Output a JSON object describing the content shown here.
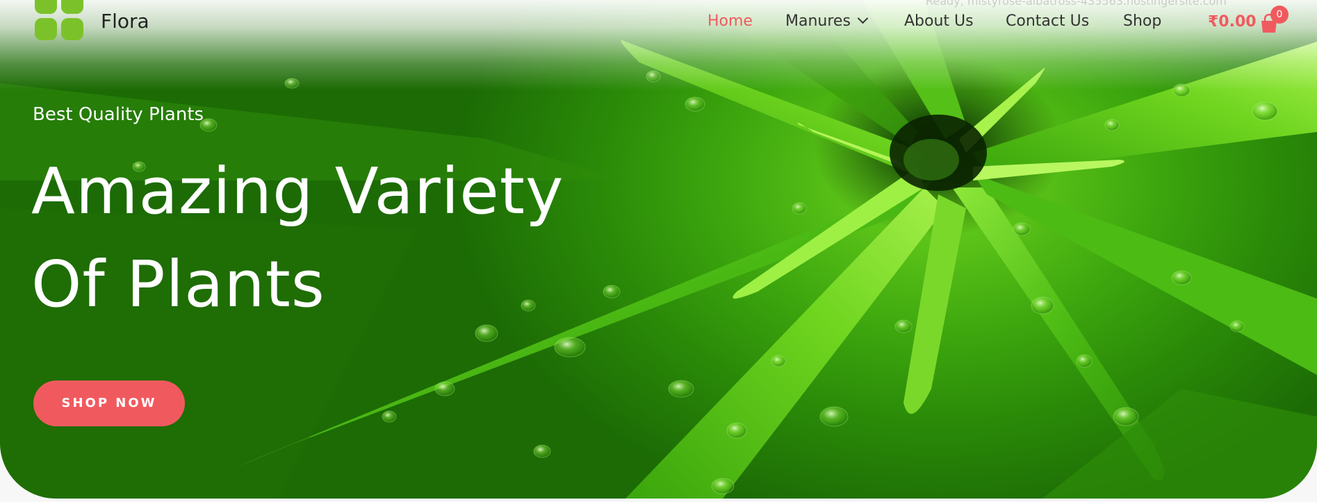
{
  "header": {
    "brand": "Flora",
    "nav": {
      "home": "Home",
      "manures": "Manures",
      "about": "About Us",
      "contact": "Contact Us",
      "shop": "Shop"
    },
    "cart_total": "₹0.00",
    "cart_count": "0",
    "url_text": "Ready, mistyrose-albatross-435563.hostingersite.com"
  },
  "hero": {
    "eyebrow": "Best Quality Plants",
    "headline_line1": "Amazing Variety",
    "headline_line2": "Of Plants",
    "cta_label": "SHOP NOW"
  },
  "colors": {
    "accent": "#f05a5f",
    "logo_green": "#7bc22a",
    "nav_text": "#333333"
  },
  "icons": {
    "logo": "four-leaf-logo-icon",
    "cart": "shopping-bag-icon",
    "dropdown": "chevron-down-icon"
  }
}
